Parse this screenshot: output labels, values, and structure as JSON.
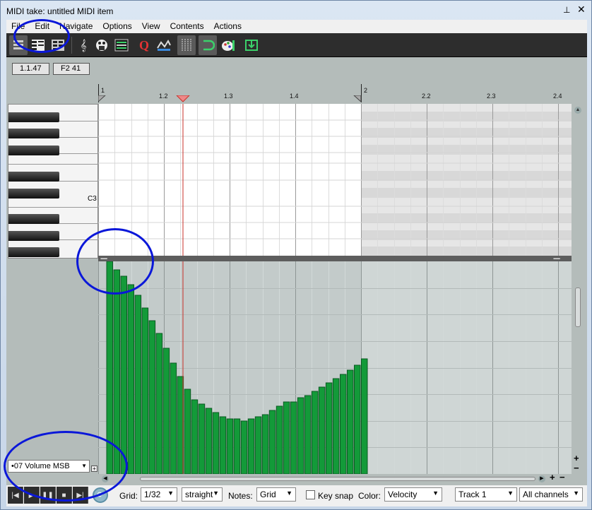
{
  "window": {
    "title": "MIDI take: untitled MIDI item"
  },
  "menu": [
    "File",
    "Edit",
    "Navigate",
    "Options",
    "View",
    "Contents",
    "Actions"
  ],
  "toolbar": {
    "icons": [
      "list-view-icon",
      "piano-roll-view-icon",
      "named-notes-view-icon",
      "treble-clef-icon",
      "piano-palette-icon",
      "event-list-icon",
      "quantize-icon",
      "humanize-icon",
      "grid-icon",
      "loop-snap-icon",
      "paint-icon",
      "insert-icon"
    ],
    "quantize_glyph": "Q"
  },
  "info": {
    "position": "1.1.47",
    "note": "F2  41"
  },
  "ruler": {
    "labels": [
      "1",
      "1.2",
      "1.3",
      "1.4",
      "2",
      "2.2",
      "2.3",
      "2.4"
    ]
  },
  "piano": {
    "c3_label": "C3"
  },
  "cc_lane": {
    "selected": "•07 Volume MSB",
    "add_glyph": "+",
    "values": [
      100,
      96,
      93,
      89,
      84,
      78,
      72,
      66,
      59,
      52,
      46,
      40,
      35,
      33,
      31,
      29,
      27,
      26,
      26,
      25,
      26,
      27,
      28,
      30,
      32,
      34,
      34,
      36,
      37,
      39,
      41,
      43,
      45,
      47,
      49,
      51,
      54
    ]
  },
  "bottom": {
    "grid_label": "Grid:",
    "grid_value": "1/32",
    "grid_mode": "straight",
    "notes_label": "Notes:",
    "notes_value": "Grid",
    "keysnap_label": "Key snap",
    "color_label": "Color:",
    "color_value": "Velocity",
    "track_value": "Track 1",
    "channel_value": "All channels"
  },
  "colors": {
    "cc_bar": "#139a39",
    "cc_bar_edge": "#0b5a22",
    "playhead": "#c8312a",
    "annotation": "#0a17d9"
  }
}
